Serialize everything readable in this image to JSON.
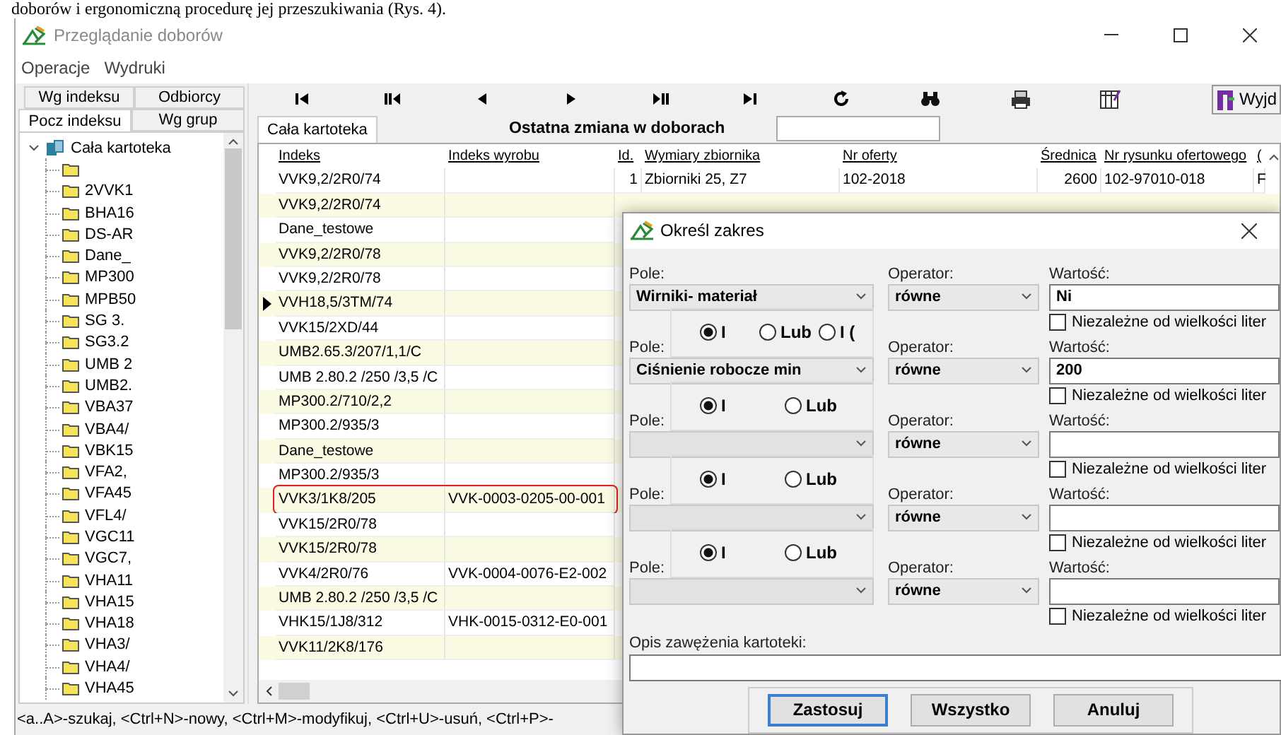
{
  "caption": "doborów i ergonomiczną procedurę jej przeszukiwania (Rys. 4).",
  "window": {
    "title": "Przeglądanie doborów",
    "menu": [
      "Operacje",
      "Wydruki"
    ]
  },
  "left_tab_rows": [
    {
      "tabs": [
        {
          "label": "Wg indeksu",
          "selected": false
        },
        {
          "label": "Odbiorcy",
          "selected": false
        }
      ]
    },
    {
      "tabs": [
        {
          "label": "Pocz indeksu",
          "selected": true
        },
        {
          "label": "Wg grup",
          "selected": false
        }
      ]
    }
  ],
  "tree": {
    "label": "Cała kartoteka",
    "expanded": true,
    "children": [
      {
        "kind": "folder"
      },
      {
        "kind": "folder",
        "label": "2VVK1"
      },
      {
        "kind": "folder",
        "label": "BHA16"
      },
      {
        "kind": "folder",
        "label": "DS-AR"
      },
      {
        "kind": "folder",
        "label": "Dane_"
      },
      {
        "kind": "folder",
        "label": "MP300"
      },
      {
        "kind": "folder",
        "label": "MPB50"
      },
      {
        "kind": "folder",
        "label": "SG 3."
      },
      {
        "kind": "folder",
        "label": "SG3.2"
      },
      {
        "kind": "folder",
        "label": "UMB 2"
      },
      {
        "kind": "folder",
        "label": "UMB2."
      },
      {
        "kind": "folder",
        "label": "VBA37"
      },
      {
        "kind": "folder",
        "label": "VBA4/"
      },
      {
        "kind": "folder",
        "label": "VBK15"
      },
      {
        "kind": "folder",
        "label": "VFA2,"
      },
      {
        "kind": "folder",
        "label": "VFA45"
      },
      {
        "kind": "folder",
        "label": "VFL4/"
      },
      {
        "kind": "folder",
        "label": "VGC11"
      },
      {
        "kind": "folder",
        "label": "VGC7,"
      },
      {
        "kind": "folder",
        "label": "VHA11"
      },
      {
        "kind": "folder",
        "label": "VHA15"
      },
      {
        "kind": "folder",
        "label": "VHA18"
      },
      {
        "kind": "folder",
        "label": "VHA3/"
      },
      {
        "kind": "folder",
        "label": "VHA4/"
      },
      {
        "kind": "folder",
        "label": "VHA45"
      }
    ]
  },
  "toolbar": {
    "exit_label": "Wyjd"
  },
  "content_tab": "Cała kartoteka",
  "last_change": {
    "label": "Ostatna zmiana w doborach"
  },
  "table": {
    "columns": [
      "Indeks",
      "Indeks wyrobu",
      "Id.",
      "Wymiary zbiornika",
      "Nr oferty",
      "Średnica",
      "Nr rysunku ofertowego",
      "("
    ],
    "rows": [
      {
        "cells": [
          "VVK9,2/2R0/74",
          "",
          "1",
          "Zbiorniki 25, Z7",
          "102-2018",
          "2600",
          "102-97010-018",
          "F"
        ],
        "current": false,
        "marked": false
      },
      {
        "cells": [
          "VVK9,2/2R0/74",
          ""
        ],
        "current": false,
        "marked": false
      },
      {
        "cells": [
          "Dane_testowe",
          ""
        ],
        "current": false,
        "marked": false
      },
      {
        "cells": [
          "VVK9,2/2R0/78",
          ""
        ],
        "current": false,
        "marked": false
      },
      {
        "cells": [
          "VVK9,2/2R0/78",
          ""
        ],
        "current": false,
        "marked": false
      },
      {
        "cells": [
          "VVH18,5/3TM/74",
          ""
        ],
        "current": true,
        "marked": false
      },
      {
        "cells": [
          "VVK15/2XD/44",
          ""
        ],
        "current": false,
        "marked": false
      },
      {
        "cells": [
          "UMB2.65.3/207/1,1/C",
          ""
        ],
        "current": false,
        "marked": false
      },
      {
        "cells": [
          "UMB 2.80.2 /250 /3,5 /C",
          ""
        ],
        "current": false,
        "marked": false
      },
      {
        "cells": [
          "MP300.2/710/2,2",
          ""
        ],
        "current": false,
        "marked": false
      },
      {
        "cells": [
          "MP300.2/935/3",
          ""
        ],
        "current": false,
        "marked": false
      },
      {
        "cells": [
          "Dane_testowe",
          ""
        ],
        "current": false,
        "marked": false
      },
      {
        "cells": [
          "MP300.2/935/3",
          ""
        ],
        "current": false,
        "marked": false
      },
      {
        "cells": [
          "VVK3/1K8/205",
          "VVK-0003-0205-00-001"
        ],
        "current": false,
        "marked": true
      },
      {
        "cells": [
          "VVK15/2R0/78",
          ""
        ],
        "current": false,
        "marked": false
      },
      {
        "cells": [
          "VVK15/2R0/78",
          ""
        ],
        "current": false,
        "marked": false
      },
      {
        "cells": [
          "VVK4/2R0/76",
          "VVK-0004-0076-E2-002"
        ],
        "current": false,
        "marked": false
      },
      {
        "cells": [
          "UMB 2.80.2 /250 /3,5 /C",
          ""
        ],
        "current": false,
        "marked": false
      },
      {
        "cells": [
          "VHK15/1J8/312",
          "VHK-0015-0312-E0-001"
        ],
        "current": false,
        "marked": false
      },
      {
        "cells": [
          "VVK11/2K8/176",
          ""
        ],
        "current": false,
        "marked": false
      }
    ]
  },
  "status_bar": "<a..A>-szukaj, <Ctrl+N>-nowy, <Ctrl+M>-modyfikuj, <Ctrl+U>-usuń, <Ctrl+P>-",
  "dialog": {
    "title": "Określ zakres",
    "conditions": [
      {
        "field_label": "Pole:",
        "operator_label": "Operator:",
        "value_label": "Wartość:",
        "field": "Wirniki- materiał",
        "operator": "równe",
        "value": "Ni",
        "case_label": "Niezależne od wielkości liter",
        "case_insensitive": false
      },
      {
        "field_label": "Pole:",
        "operator_label": "Operator:",
        "value_label": "Wartość:",
        "field": "Ciśnienie robocze min",
        "operator": "równe",
        "value": "200",
        "case_label": "Niezależne od wielkości liter",
        "case_insensitive": false,
        "connectors": [
          {
            "label": "I",
            "selected": true
          },
          {
            "label": "Lub",
            "selected": false
          },
          {
            "label": "I (",
            "selected": false
          }
        ]
      },
      {
        "field_label": "Pole:",
        "operator_label": "Operator:",
        "value_label": "Wartość:",
        "operator": "równe",
        "case_label": "Niezależne od wielkości liter",
        "case_insensitive": false,
        "connectors": [
          {
            "label": "I",
            "selected": true
          },
          {
            "label": "Lub",
            "selected": false
          }
        ]
      },
      {
        "field_label": "Pole:",
        "operator_label": "Operator:",
        "value_label": "Wartość:",
        "operator": "równe",
        "case_label": "Niezależne od wielkości liter",
        "case_insensitive": false,
        "connectors": [
          {
            "label": "I",
            "selected": true
          },
          {
            "label": "Lub",
            "selected": false
          }
        ]
      },
      {
        "field_label": "Pole:",
        "operator_label": "Operator:",
        "value_label": "Wartość:",
        "operator": "równe",
        "case_label": "Niezależne od wielkości liter",
        "case_insensitive": false,
        "connectors": [
          {
            "label": "I",
            "selected": true
          },
          {
            "label": "Lub",
            "selected": false
          }
        ]
      }
    ],
    "description_label": "Opis zawężenia kartoteki:",
    "buttons": [
      {
        "label": "Zastosuj",
        "default": true
      },
      {
        "label": "Wszystko",
        "default": false
      },
      {
        "label": "Anuluj",
        "default": false
      }
    ]
  }
}
